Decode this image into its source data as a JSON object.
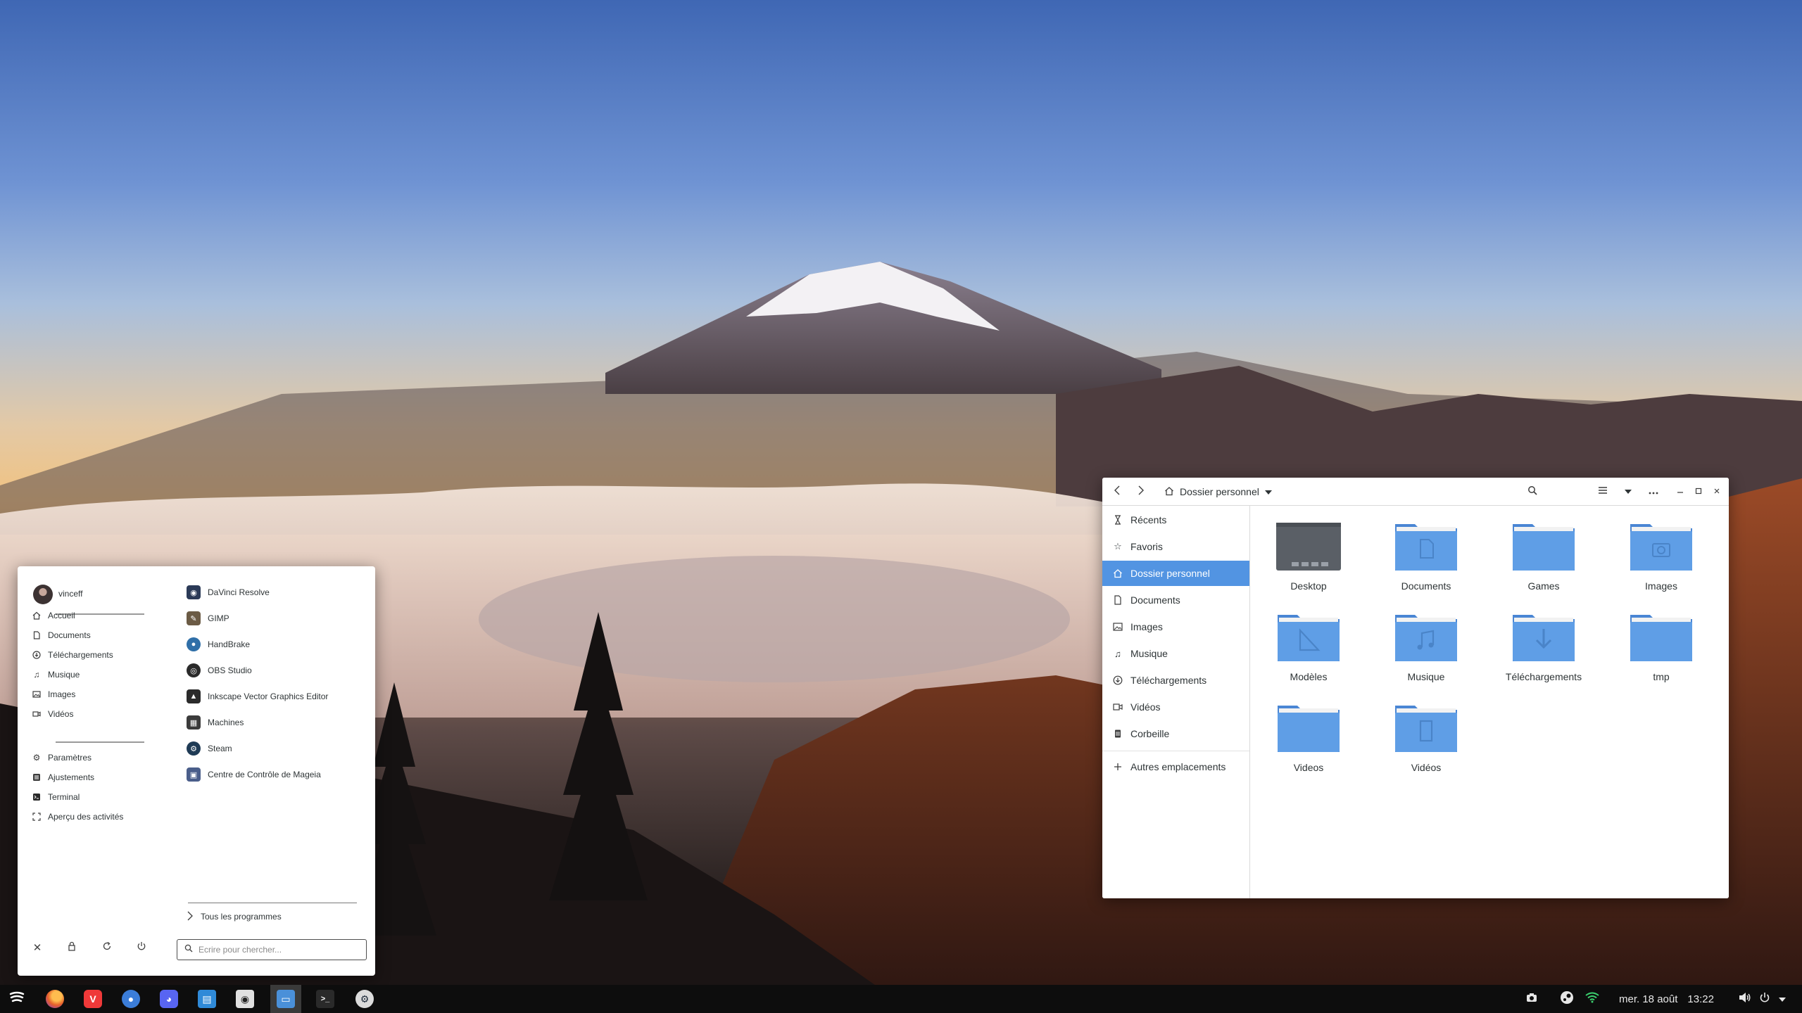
{
  "file_manager": {
    "location": "Dossier personnel",
    "sidebar": [
      {
        "label": "Récents",
        "icon": "clock-icon"
      },
      {
        "label": "Favoris",
        "icon": "star-icon"
      },
      {
        "label": "Dossier personnel",
        "icon": "home-icon",
        "active": true
      },
      {
        "label": "Documents",
        "icon": "document-icon"
      },
      {
        "label": "Images",
        "icon": "image-icon"
      },
      {
        "label": "Musique",
        "icon": "music-icon"
      },
      {
        "label": "Téléchargements",
        "icon": "download-icon"
      },
      {
        "label": "Vidéos",
        "icon": "video-icon"
      },
      {
        "label": "Corbeille",
        "icon": "trash-icon"
      }
    ],
    "other_locations": "Autres emplacements",
    "folders": [
      {
        "label": "Desktop",
        "emblem": "desktop"
      },
      {
        "label": "Documents",
        "emblem": "document"
      },
      {
        "label": "Games",
        "emblem": "none"
      },
      {
        "label": "Images",
        "emblem": "camera"
      },
      {
        "label": "Modèles",
        "emblem": "template"
      },
      {
        "label": "Musique",
        "emblem": "music"
      },
      {
        "label": "Téléchargements",
        "emblem": "download"
      },
      {
        "label": "tmp",
        "emblem": "none"
      },
      {
        "label": "Videos",
        "emblem": "none"
      },
      {
        "label": "Vidéos",
        "emblem": "film"
      }
    ]
  },
  "menu": {
    "username": "vinceff",
    "places": [
      {
        "label": "Accueil",
        "icon": "home-icon"
      },
      {
        "label": "Documents",
        "icon": "document-icon"
      },
      {
        "label": "Téléchargements",
        "icon": "download-icon"
      },
      {
        "label": "Musique",
        "icon": "music-icon"
      },
      {
        "label": "Images",
        "icon": "image-icon"
      },
      {
        "label": "Vidéos",
        "icon": "video-icon"
      }
    ],
    "system": [
      {
        "label": "Paramètres",
        "icon": "gear-icon"
      },
      {
        "label": "Ajustements",
        "icon": "tweaks-icon"
      },
      {
        "label": "Terminal",
        "icon": "terminal-icon"
      },
      {
        "label": "Aperçu des activités",
        "icon": "activities-icon"
      }
    ],
    "apps": [
      {
        "label": "DaVinci Resolve",
        "icon": "davinci-resolve-icon",
        "color": "#2b3a57"
      },
      {
        "label": "GIMP",
        "icon": "gimp-icon",
        "color": "#6b5b45"
      },
      {
        "label": "HandBrake",
        "icon": "handbrake-icon",
        "color": "#2f6fa8"
      },
      {
        "label": "OBS Studio",
        "icon": "obs-studio-icon",
        "color": "#2a2a2a"
      },
      {
        "label": "Inkscape Vector Graphics Editor",
        "icon": "inkscape-icon",
        "color": "#2b2b2b"
      },
      {
        "label": "Machines",
        "icon": "machines-icon",
        "color": "#3b3b3b"
      },
      {
        "label": "Steam",
        "icon": "steam-icon",
        "color": "#1f3b55"
      },
      {
        "label": "Centre de Contrôle de Mageia",
        "icon": "mageia-control-center-icon",
        "color": "#4a5e8a"
      }
    ],
    "all_programs": "Tous les programmes",
    "search_placeholder": "Ecrire pour chercher..."
  },
  "taskbar": {
    "apps": [
      {
        "icon": "mageia-menu-icon",
        "color": "#0d0d0d",
        "active": false
      },
      {
        "icon": "firefox-icon",
        "color": "#e6602a",
        "active": false
      },
      {
        "icon": "vivaldi-icon",
        "color": "#ef3939",
        "active": false
      },
      {
        "icon": "chat-icon",
        "color": "#3b7dd8",
        "active": false
      },
      {
        "icon": "discord-icon",
        "color": "#5865f2",
        "active": false
      },
      {
        "icon": "messaging-icon",
        "color": "#2f8ad8",
        "active": false
      },
      {
        "icon": "speaker-app-icon",
        "color": "#e0e0e0",
        "active": false
      },
      {
        "icon": "files-icon",
        "color": "#4a90d9",
        "active": true
      },
      {
        "icon": "terminal-icon",
        "color": "#2a2a2a",
        "active": false
      },
      {
        "icon": "steam-icon",
        "color": "#dcdcdc",
        "active": false
      }
    ],
    "date": "mer. 18 août",
    "time": "13:22"
  },
  "colors": {
    "accent": "#5294e2",
    "folder_blue": "#5f9ee6",
    "taskbar": "#0d0d0d"
  }
}
